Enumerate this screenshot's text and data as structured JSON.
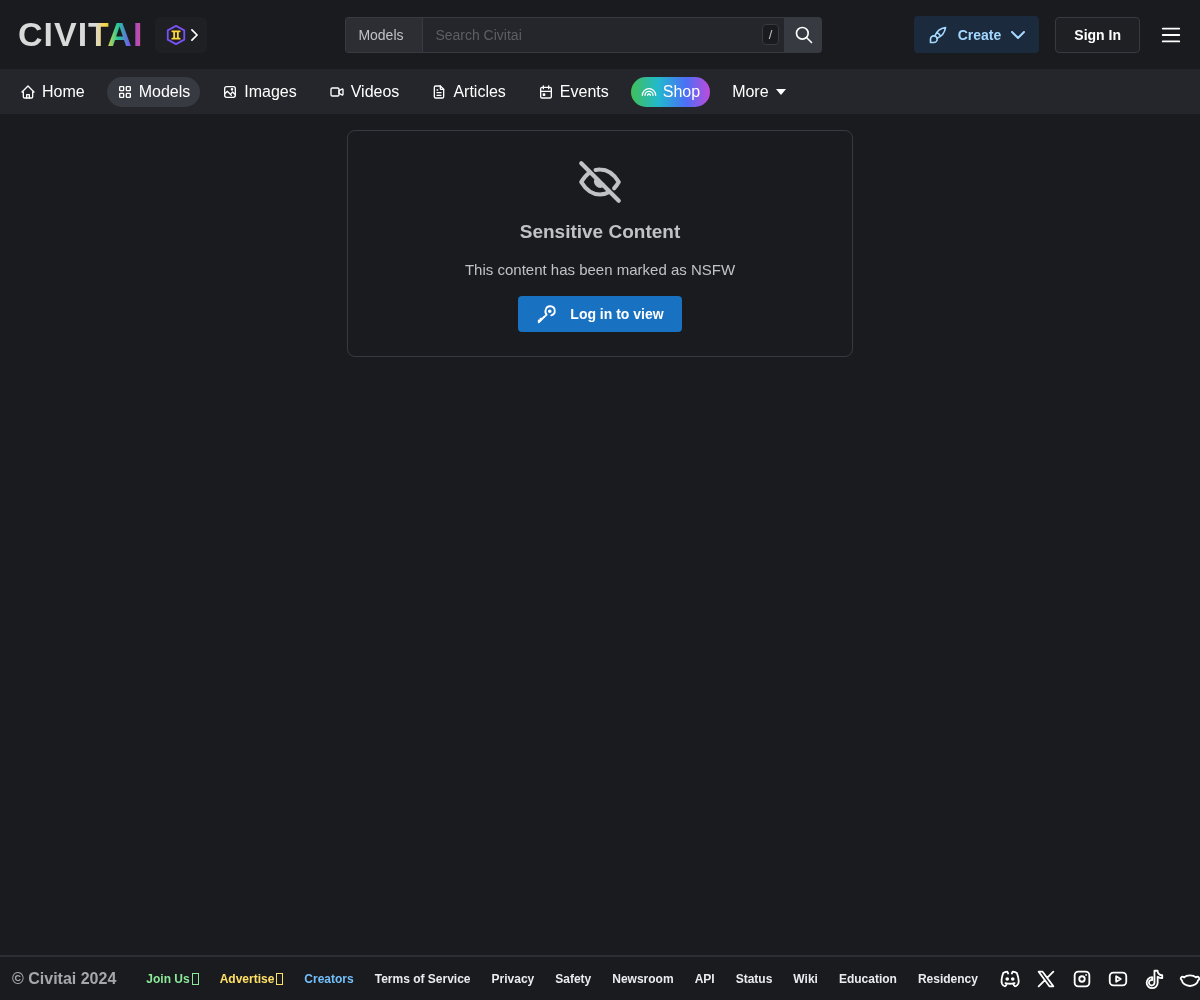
{
  "header": {
    "logo": "CIVITAI",
    "search": {
      "scope": "Models",
      "placeholder": "Search Civitai",
      "shortcut": "/"
    },
    "create_button": "Create",
    "sign_in_button": "Sign In"
  },
  "nav": [
    {
      "label": "Home",
      "kind": "link",
      "selected": false
    },
    {
      "label": "Models",
      "kind": "link",
      "selected": true
    },
    {
      "label": "Images",
      "kind": "link",
      "selected": false
    },
    {
      "label": "Videos",
      "kind": "link",
      "selected": false
    },
    {
      "label": "Articles",
      "kind": "link",
      "selected": false
    },
    {
      "label": "Events",
      "kind": "link",
      "selected": false
    },
    {
      "label": "Shop",
      "kind": "shop"
    },
    {
      "label": "More",
      "kind": "dropdown"
    }
  ],
  "notice": {
    "title": "Sensitive Content",
    "message": "This content has been marked as NSFW",
    "button": "Log in to view"
  },
  "footer": {
    "copyright": "© Civitai 2024",
    "links": [
      {
        "label": "Join Us",
        "color": "#8ce99a",
        "external": true
      },
      {
        "label": "Advertise",
        "color": "#ffe066",
        "external": true
      },
      {
        "label": "Creators",
        "color": "#74c0fc",
        "external": false
      },
      {
        "label": "Terms of Service",
        "color": "#e9ecef",
        "external": false
      },
      {
        "label": "Privacy",
        "color": "#e9ecef",
        "external": false
      },
      {
        "label": "Safety",
        "color": "#e9ecef",
        "external": false
      },
      {
        "label": "Newsroom",
        "color": "#e9ecef",
        "external": false
      },
      {
        "label": "API",
        "color": "#e9ecef",
        "external": false
      },
      {
        "label": "Status",
        "color": "#e9ecef",
        "external": false
      },
      {
        "label": "Wiki",
        "color": "#e9ecef",
        "external": false
      },
      {
        "label": "Education",
        "color": "#e9ecef",
        "external": false
      },
      {
        "label": "Residency",
        "color": "#e9ecef",
        "external": false
      }
    ]
  }
}
